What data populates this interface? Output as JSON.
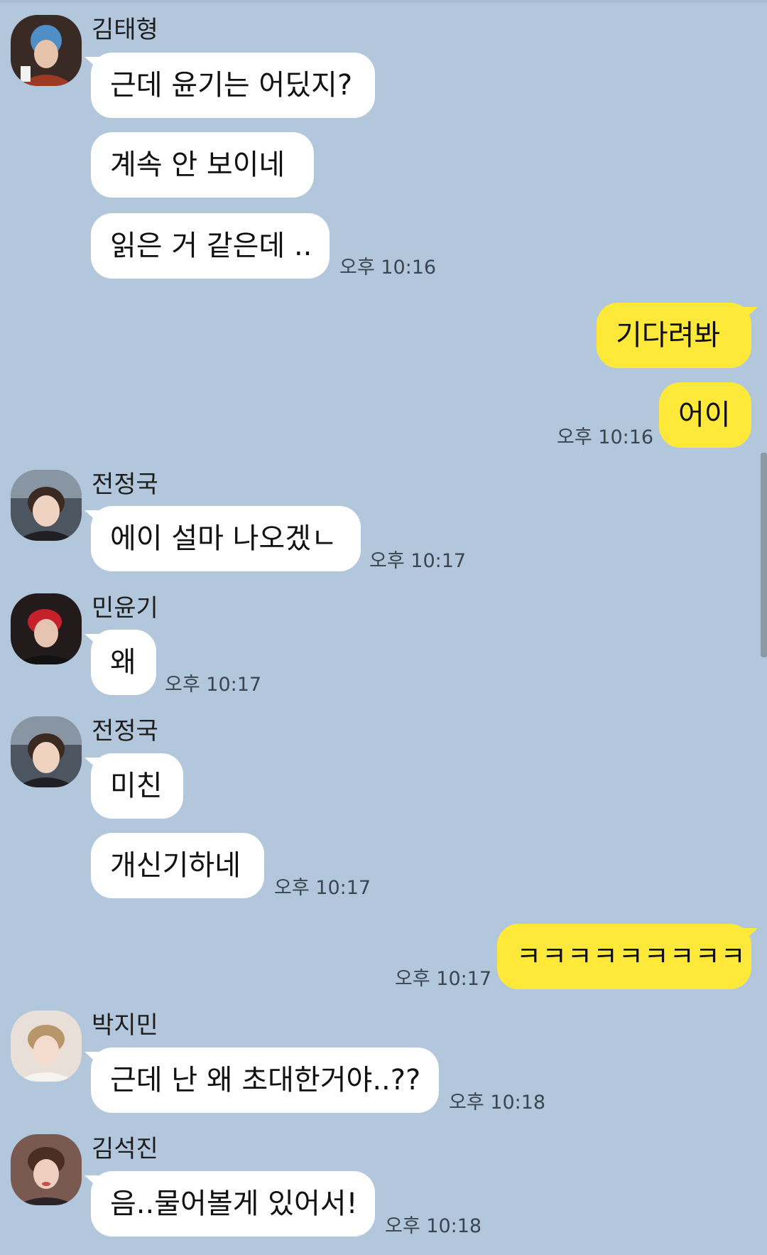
{
  "colors": {
    "background": "#b3c7dc",
    "incoming_bubble": "#ffffff",
    "outgoing_bubble": "#fee93a"
  },
  "messages": [
    {
      "sender": "김태형",
      "avatar": "avatar-taehyung",
      "lines": [
        "근데 윤기는 어딨지?",
        "계속 안 보이네",
        "읽은 거 같은데 .."
      ],
      "time": "오후 10:16"
    },
    {
      "me": true,
      "lines": [
        "기다려봐",
        "어이"
      ],
      "time": "오후 10:16"
    },
    {
      "sender": "전정국",
      "avatar": "avatar-jungkook",
      "lines": [
        "에이 설마 나오겠ㄴ"
      ],
      "time": "오후 10:17"
    },
    {
      "sender": "민윤기",
      "avatar": "avatar-yoongi",
      "lines": [
        "왜"
      ],
      "time": "오후 10:17"
    },
    {
      "sender": "전정국",
      "avatar": "avatar-jungkook",
      "lines": [
        "미친",
        "개신기하네"
      ],
      "time": "오후 10:17"
    },
    {
      "me": true,
      "lines": [
        "ㅋㅋㅋㅋㅋㅋㅋㅋㅋ"
      ],
      "time": "오후 10:17"
    },
    {
      "sender": "박지민",
      "avatar": "avatar-jimin",
      "lines": [
        "근데 난 왜 초대한거야..??"
      ],
      "time": "오후 10:18"
    },
    {
      "sender": "김석진",
      "avatar": "avatar-seokjin",
      "lines": [
        "음..물어볼게 있어서!"
      ],
      "time": "오후 10:18"
    }
  ]
}
